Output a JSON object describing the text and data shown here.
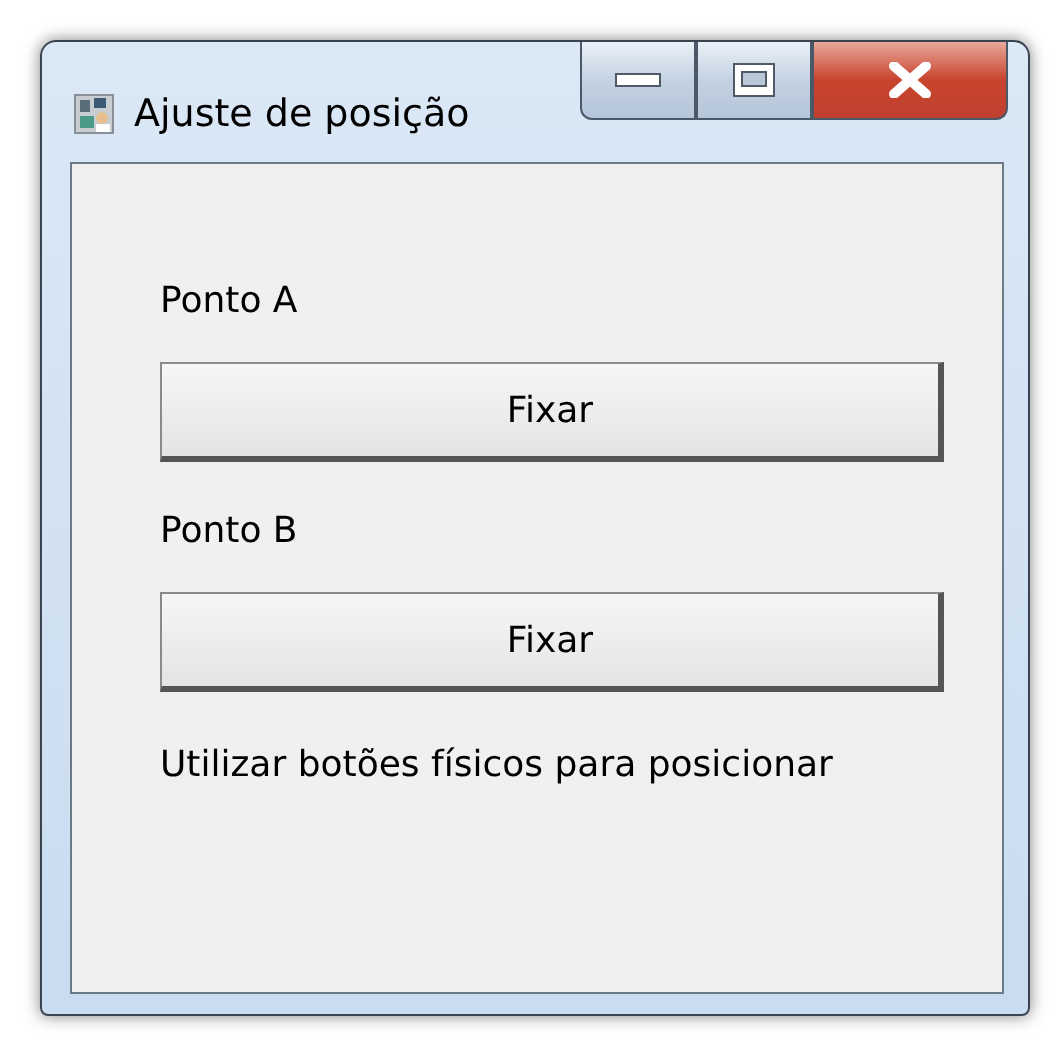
{
  "window": {
    "title": "Ajuste de posição"
  },
  "sections": [
    {
      "label": "Ponto A",
      "button": "Fixar"
    },
    {
      "label": "Ponto B",
      "button": "Fixar"
    }
  ],
  "hint": "Utilizar botões físicos para posicionar"
}
